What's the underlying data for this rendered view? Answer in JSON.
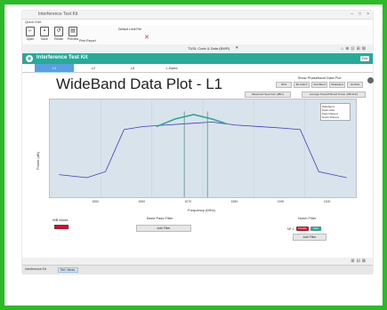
{
  "window": {
    "title": "Interference Test Kit",
    "controls": [
      "–",
      "□",
      "×"
    ]
  },
  "menu": {
    "label": "Quick Edit"
  },
  "ribbon": {
    "buttons": [
      {
        "label": "Open",
        "icon": "folder-icon"
      },
      {
        "label": "Save",
        "icon": "save-icon"
      },
      {
        "label": "Recall",
        "icon": "recall-icon"
      },
      {
        "label": "Preview",
        "icon": "preview-icon"
      },
      {
        "label": "Print Report",
        "icon": "print-icon"
      }
    ],
    "field": "Default Limit File"
  },
  "selection_bar": {
    "label": "TUSL Code & Data (BWR)"
  },
  "app": {
    "title": "Interference Test Kit",
    "exit_label": "Exit"
  },
  "tabs": [
    {
      "label": "L1",
      "active": true
    },
    {
      "label": "L2",
      "active": false
    },
    {
      "label": "L5",
      "active": false
    },
    {
      "label": "L-Band",
      "active": false
    }
  ],
  "plot": {
    "title": "WideBand Data Plot - L1",
    "phaseband": {
      "heading": "Show Phaseband Data Plot",
      "options": [
        "50%",
        "Be Attach",
        "Sub-Band",
        "Wideband",
        "GLONA"
      ]
    },
    "subselect_left": "Measured Spectrum (dBm)",
    "subselect_right": "Average Power/Filtered Power (dBm/Hz)",
    "ylabel": "Power (dB)",
    "xlabel": "Frequency (MHz)",
    "xticks": [
      "1550",
      "1560",
      "1570",
      "1580",
      "1590",
      "1600"
    ],
    "legend": [
      "Wideband",
      "Peak Hold",
      "Pass Filtered",
      "Notch Filtered"
    ]
  },
  "chart_data": {
    "type": "line",
    "xlabel": "Frequency (MHz)",
    "ylabel": "Power (dB)",
    "series": [
      {
        "x": [
          1542,
          1548,
          1552,
          1556,
          1560,
          1565,
          1570,
          1575,
          1580,
          1585,
          1590,
          1594,
          1598,
          1604
        ],
        "values": [
          -110,
          -112,
          -108,
          -80,
          -78,
          -77,
          -76,
          -75,
          -77,
          -78,
          -79,
          -80,
          -108,
          -112
        ]
      },
      {
        "x": [
          1563,
          1567,
          1571,
          1575,
          1578
        ],
        "values": [
          -78,
          -73,
          -70,
          -73,
          -76
        ]
      }
    ],
    "grid": true,
    "legend_position": "top-right"
  },
  "controls": {
    "wideband_label": "WB Mode",
    "bandpass_label": "Band Pass Filter",
    "bandpass_button": "Add Filter",
    "notch_label": "Notch Filter",
    "nf_label": "NF 1",
    "notch_disable": "Disable",
    "notch_edit": "Edit",
    "notch_button": "Add Filter"
  },
  "colors": {
    "accent": "#2aa898",
    "tab_active": "#5a9fe0",
    "frame": "#2fb82a",
    "trace": "#3b3bd0",
    "notch": "#2aa898",
    "wb_button": "#d0102a"
  },
  "taskbar": {
    "items": [
      "Interference Kit",
      "Ref. Meas."
    ]
  }
}
